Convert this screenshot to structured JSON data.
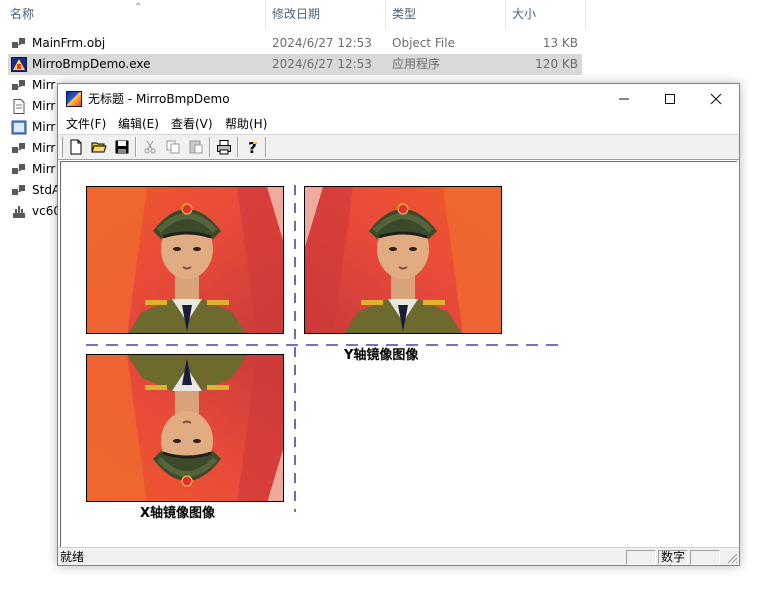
{
  "explorer": {
    "columns": {
      "name": "名称",
      "date": "修改日期",
      "type": "类型",
      "size": "大小"
    },
    "files": [
      {
        "icon": "obj-file-icon",
        "name": "MainFrm.obj",
        "date": "2024/6/27 12:53",
        "type": "Object File",
        "size": "13 KB",
        "selected": false
      },
      {
        "icon": "exe-app-icon",
        "name": "MirroBmpDemo.exe",
        "date": "2024/6/27 12:53",
        "type": "应用程序",
        "size": "120 KB",
        "selected": true
      },
      {
        "icon": "obj-file-icon",
        "name": "Mirr",
        "date": "",
        "type": "",
        "size": "",
        "selected": false
      },
      {
        "icon": "text-file-icon",
        "name": "Mirr",
        "date": "",
        "type": "",
        "size": "",
        "selected": false
      },
      {
        "icon": "resource-file-icon",
        "name": "Mirr",
        "date": "",
        "type": "",
        "size": "",
        "selected": false
      },
      {
        "icon": "obj-file-icon",
        "name": "Mirr",
        "date": "",
        "type": "",
        "size": "",
        "selected": false
      },
      {
        "icon": "obj-file-icon",
        "name": "Mirr",
        "date": "",
        "type": "",
        "size": "",
        "selected": false
      },
      {
        "icon": "obj-file-icon",
        "name": "StdA",
        "date": "",
        "type": "",
        "size": "",
        "selected": false
      },
      {
        "icon": "db-file-icon",
        "name": "vc60",
        "date": "",
        "type": "",
        "size": "",
        "selected": false
      }
    ]
  },
  "app": {
    "title": "无标题 - MirroBmpDemo",
    "menu": [
      "文件(F)",
      "编辑(E)",
      "查看(V)",
      "帮助(H)"
    ],
    "toolbar": [
      "new-icon",
      "open-icon",
      "save-icon",
      "cut-icon",
      "copy-icon",
      "paste-icon",
      "print-icon",
      "help-icon"
    ],
    "captions": {
      "y_mirror": "Y轴镜像图像",
      "x_mirror": "X轴镜像图像"
    },
    "status": {
      "text": "就绪",
      "num": "数字"
    },
    "colors": {
      "axis_line": "#1a1aa0",
      "title_border": "#4a90d9"
    }
  }
}
